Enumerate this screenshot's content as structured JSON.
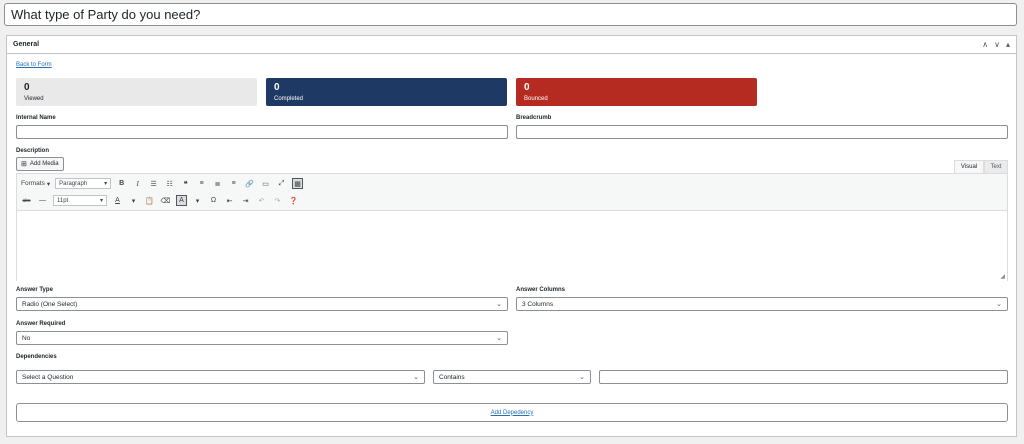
{
  "title_value": "What type of Party do you need?",
  "postbox": {
    "title": "General",
    "actions": [
      "∧",
      "∨",
      "▴"
    ]
  },
  "back_link": "Back to Form",
  "stats": {
    "viewed": {
      "value": "0",
      "label": "Viewed",
      "color": "#e9e9ea"
    },
    "completed": {
      "value": "0",
      "label": "Completed",
      "color": "#1e3964"
    },
    "bounced": {
      "value": "0",
      "label": "Bounced",
      "color": "#b52b22"
    }
  },
  "fields": {
    "internal_name": {
      "label": "Internal Name",
      "value": ""
    },
    "breadcrumb": {
      "label": "Breadcrumb",
      "value": ""
    },
    "description_label": "Description"
  },
  "editor": {
    "add_media": "Add Media",
    "tab_visual": "Visual",
    "tab_text": "Text",
    "formats_label": "Formats",
    "paragraph": "Paragraph",
    "font_size": "11pt"
  },
  "answer_type": {
    "label": "Answer Type",
    "value": "Radio (One Select)"
  },
  "answer_columns": {
    "label": "Answer Columns",
    "value": "3 Columns"
  },
  "answer_required": {
    "label": "Answer Required",
    "value": "No"
  },
  "dependencies": {
    "label": "Dependencies",
    "question": "Select a Question",
    "operator": "Contains",
    "value": "",
    "add_button": "Add Depedency"
  }
}
